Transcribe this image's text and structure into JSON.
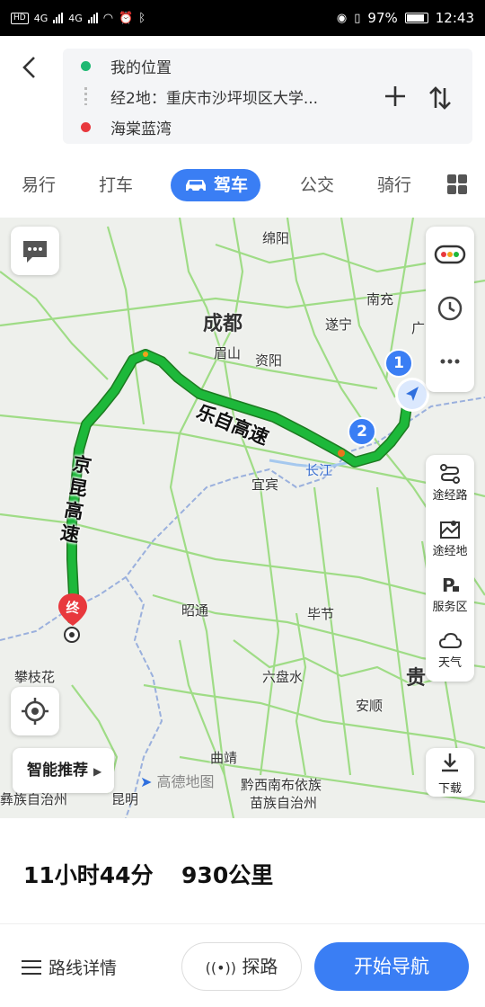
{
  "status_bar": {
    "left_chips": [
      "HD",
      "4G",
      "4G"
    ],
    "battery": "97%",
    "time": "12:43"
  },
  "route": {
    "origin": "我的位置",
    "waypoint": "经2地：重庆市沙坪坝区大学...",
    "destination": "海棠蓝湾"
  },
  "tabs": [
    {
      "label": "易行",
      "active": false
    },
    {
      "label": "打车",
      "active": false
    },
    {
      "label": "驾车",
      "active": true
    },
    {
      "label": "公交",
      "active": false
    },
    {
      "label": "骑行",
      "active": false
    }
  ],
  "map": {
    "labels": {
      "mianyang": "绵阳",
      "nanchong": "南充",
      "chengdu": "成都",
      "suining": "遂宁",
      "meishan": "眉山",
      "ziyang": "资阳",
      "yibin": "宜宾",
      "changjiang": "长江",
      "zhaotong": "昭通",
      "bijie": "毕节",
      "liupanshui": "六盘水",
      "anshun": "安顺",
      "panzhihua": "攀枝花",
      "qujing": "曲靖",
      "qiannan": "黔西南布依族",
      "qiannan2": "苗族自治州",
      "kunming": "昆明",
      "chuxiong": "彝族自治州",
      "gui": "贵",
      "guang": "广"
    },
    "highway_1": "乐自高速",
    "highway_2": "京昆高速",
    "end_marker": "终",
    "waypoint_1": "1",
    "waypoint_2": "2",
    "side_panel": {
      "via_road": "途经路",
      "via_place": "途经地",
      "service_area": "服务区",
      "weather": "天气"
    },
    "smart_recommend": "智能推荐",
    "brand": "高德地图",
    "download": "下载"
  },
  "summary": {
    "duration": "11小时44分",
    "distance": "930公里"
  },
  "bottom": {
    "route_details": "路线详情",
    "explore": "探路",
    "start_nav": "开始导航"
  },
  "colors": {
    "accent": "#3a7ef4",
    "route": "#1db83a",
    "origin_dot": "#1db872",
    "dest_dot": "#e8383d"
  }
}
